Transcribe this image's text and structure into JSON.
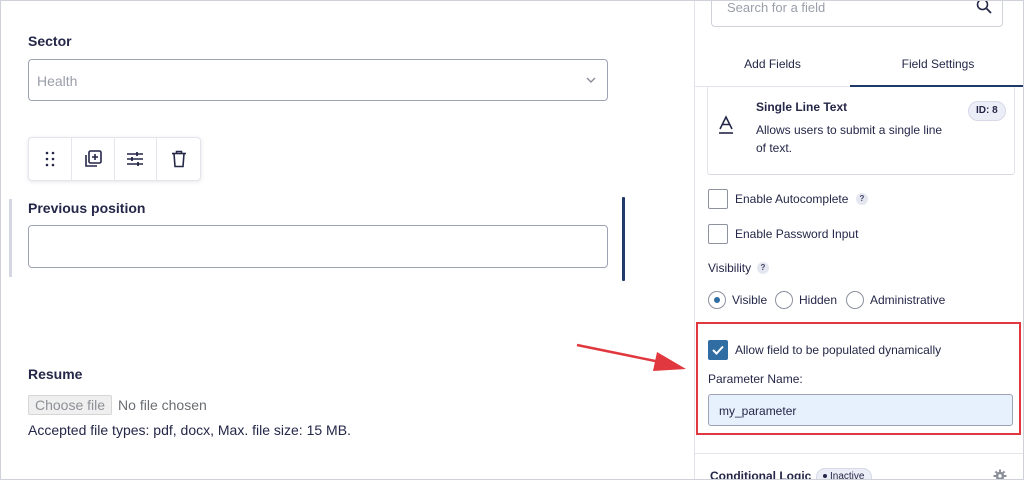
{
  "editor": {
    "sector": {
      "label": "Sector",
      "selected": "Health"
    },
    "previous_position": {
      "label": "Previous position",
      "value": ""
    },
    "resume": {
      "label": "Resume",
      "choose_file_label": "Choose file",
      "no_file_text": "No file chosen",
      "help_text": "Accepted file types: pdf, docx, Max. file size: 15 MB."
    },
    "toolbar": {
      "icons": [
        "drag-handle-icon",
        "duplicate-icon",
        "settings-sliders-icon",
        "trash-icon"
      ]
    }
  },
  "sidebar": {
    "search": {
      "placeholder": "Search for a field"
    },
    "tabs": [
      {
        "label": "Add Fields",
        "active": false
      },
      {
        "label": "Field Settings",
        "active": true
      }
    ],
    "field_card": {
      "name": "Single Line Text",
      "description": "Allows users to submit a single line of text.",
      "id_badge": "ID: 8"
    },
    "enable_autocomplete": {
      "label": "Enable Autocomplete",
      "checked": false,
      "help": "?"
    },
    "enable_password_input": {
      "label": "Enable Password Input",
      "checked": false
    },
    "visibility": {
      "label": "Visibility",
      "help": "?",
      "options": [
        {
          "label": "Visible",
          "selected": true
        },
        {
          "label": "Hidden",
          "selected": false
        },
        {
          "label": "Administrative",
          "selected": false
        }
      ]
    },
    "dynamic_population": {
      "label": "Allow field to be populated dynamically",
      "checked": true,
      "parameter_label": "Parameter Name:",
      "parameter_value": "my_parameter"
    },
    "conditional_logic": {
      "label": "Conditional Logic",
      "status": "Inactive"
    }
  },
  "colors": {
    "primary": "#242748",
    "accent": "#2f6da3",
    "tab_active": "#1f3a68",
    "highlight_red": "#e0383e",
    "param_bg": "#e7f0fd"
  }
}
